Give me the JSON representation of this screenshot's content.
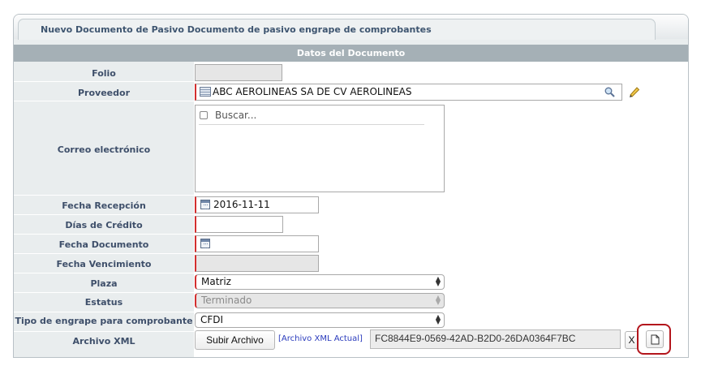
{
  "tab": {
    "title": "Nuevo Documento de Pasivo Documento de pasivo engrape de comprobantes"
  },
  "section": {
    "title": "Datos del Documento"
  },
  "labels": {
    "folio": "Folio",
    "proveedor": "Proveedor",
    "correo": "Correo electrónico",
    "fecha_recepcion": "Fecha Recepción",
    "dias_credito": "Días de Crédito",
    "fecha_documento": "Fecha Documento",
    "fecha_vencimiento": "Fecha Vencimiento",
    "plaza": "Plaza",
    "estatus": "Estatus",
    "tipo_engrape": "Tipo de engrape para comprobante",
    "archivo_xml": "Archivo XML"
  },
  "fields": {
    "folio": "",
    "proveedor": "ABC AEROLINEAS SA DE CV AEROLINEAS",
    "correo_search_placeholder": "Buscar...",
    "fecha_recepcion": "2016-11-11",
    "dias_credito": "",
    "fecha_documento": "",
    "fecha_vencimiento": "",
    "plaza": "Matriz",
    "estatus": "Terminado",
    "tipo_engrape": "CFDI",
    "subir_archivo_label": "Subir Archivo",
    "archivo_actual_link": "[Archivo XML Actual]",
    "archivo_actual_value": "FC8844E9-0569-42AD-B2D0-26DA0364F7BC",
    "clear_label": "X"
  },
  "icons": {
    "proveedor_list": "list-icon",
    "proveedor_search": "search-icon",
    "proveedor_edit": "pencil-icon",
    "date_picker": "calendar-icon",
    "view_file": "document-icon"
  },
  "colors": {
    "required_marker": "#d32f2f",
    "section_header": "#a5b0b6",
    "label_text": "#3e4f6a",
    "highlight": "#b3151c",
    "link": "#2a3bbd"
  }
}
